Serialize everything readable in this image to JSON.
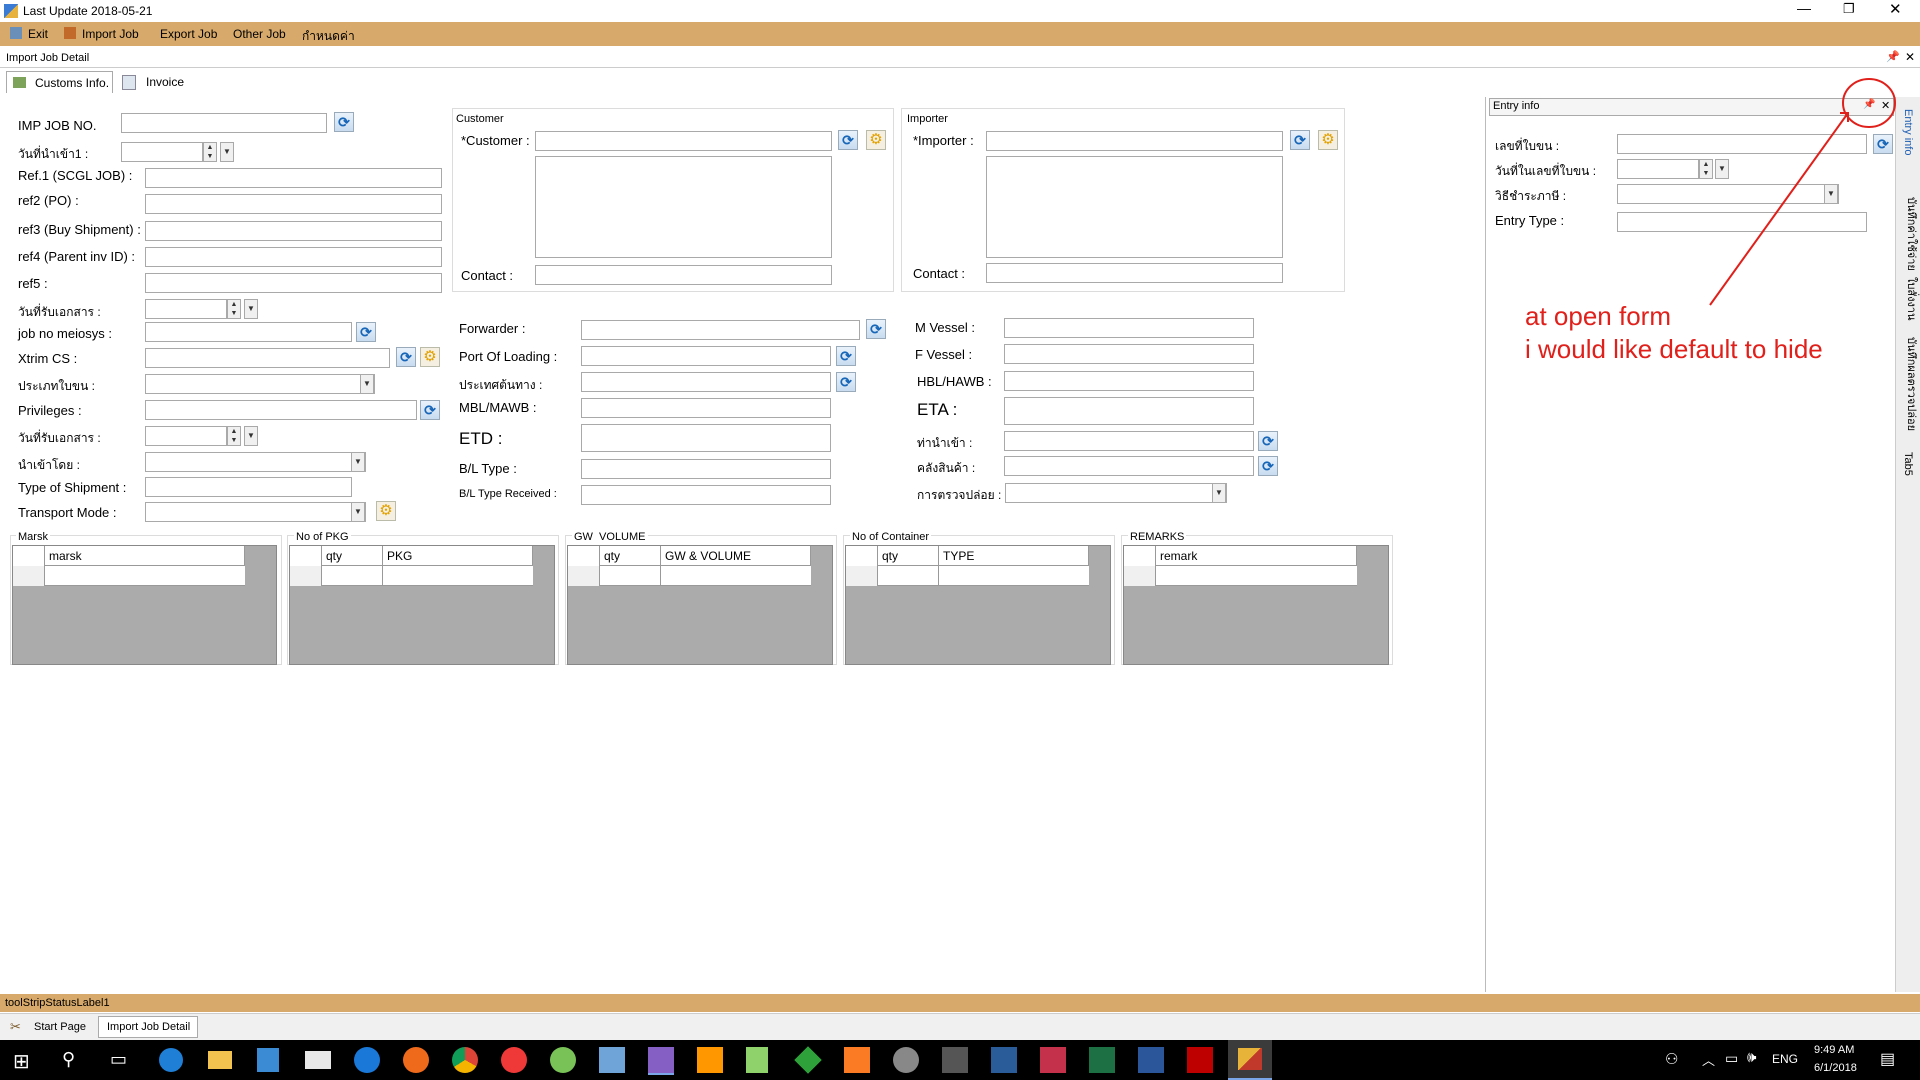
{
  "window": {
    "title": "Last Update 2018-05-21"
  },
  "menu": [
    {
      "label": "Exit"
    },
    {
      "label": "Import Job"
    },
    {
      "label": "Export Job"
    },
    {
      "label": "Other Job"
    },
    {
      "label": "กำหนดค่า"
    }
  ],
  "doc_title": "Import Job Detail",
  "tabs": [
    {
      "label": "Customs Info."
    },
    {
      "label": "Invoice"
    }
  ],
  "left_fields": {
    "imp_job_no": "IMP JOB NO.",
    "date_import1": "วันที่นำเข้า1 :",
    "ref1": "Ref.1 (SCGL JOB) :",
    "ref2": "ref2 (PO) :",
    "ref3": "ref3 (Buy Shipment) :",
    "ref4": "ref4 (Parent inv ID) :",
    "ref5": "ref5 :",
    "date_doc_received": "วันที่รับเอกสาร :",
    "job_no_meiosys": "job no meiosys :",
    "xtrim_cs": "Xtrim CS :",
    "entry_type_th": "ประเภทใบขน :",
    "privileges": "Privileges :",
    "date_doc_received2": "วันที่รับเอกสาร :",
    "import_by": "นำเข้าโดย :",
    "type_of_shipment": "Type of Shipment :",
    "transport_mode": "Transport Mode :"
  },
  "customer": {
    "group_title": "Customer",
    "customer_label": "*Customer :",
    "contact_label": "Contact :"
  },
  "importer": {
    "group_title": "Importer",
    "importer_label": "*Importer :",
    "contact_label": "Contact :"
  },
  "middle_fields": {
    "forwarder": "Forwarder :",
    "port_of_loading": "Port Of Loading :",
    "origin_country": "ประเทศต้นทาง :",
    "mbl_mawb": "MBL/MAWB :",
    "etd": "ETD :",
    "bl_type": "B/L Type :",
    "bl_type_received": "B/L Type Received :"
  },
  "right_fields": {
    "m_vessel": "M Vessel :",
    "f_vessel": "F Vessel :",
    "hbl_hawb": "HBL/HAWB :",
    "eta": "ETA :",
    "port_of_entry": "ท่านำเข้า :",
    "warehouse": "คลังสินค้า :",
    "inspection_release": "การตรวจปล่อย :"
  },
  "grids": [
    {
      "title": "Marsk",
      "columns": [
        "marsk"
      ]
    },
    {
      "title": "No of PKG",
      "columns": [
        "qty",
        "PKG"
      ]
    },
    {
      "title": "GW  VOLUME",
      "columns": [
        "qty",
        "GW & VOLUME"
      ]
    },
    {
      "title": "No of Container",
      "columns": [
        "qty",
        "TYPE"
      ]
    },
    {
      "title": "REMARKS",
      "columns": [
        "remark"
      ]
    }
  ],
  "entry_panel": {
    "title": "Entry info",
    "entry_no": "เลขที่ใบขน :",
    "entry_date": "วันที่ในเลขที่ใบขน :",
    "tax_method": "วิธีชำระภาษี :",
    "entry_type": "Entry Type :"
  },
  "side_tabs": [
    {
      "label": "Entry info"
    },
    {
      "label": "บันทึกค่าใช้จ่าย"
    },
    {
      "label": "ใบสั่งงาน"
    },
    {
      "label": "บันทึกผลตรวจปล่อย"
    },
    {
      "label": "Tab5"
    }
  ],
  "annotation": {
    "line1": "at open form",
    "line2": "i would like default to hide",
    "color": "#e0201b"
  },
  "status_bar": {
    "text": "toolStripStatusLabel1"
  },
  "bottom_tabs": [
    {
      "label": "Start Page"
    },
    {
      "label": "Import Job Detail"
    }
  ],
  "taskbar": {
    "lang": "ENG",
    "time": "9:49 AM",
    "date": "6/1/2018"
  },
  "colors": {
    "menu_bar": "#d7a96a",
    "status_bar": "#d7a96a",
    "taskbar": "#000000",
    "grid_bg": "#ababab"
  }
}
